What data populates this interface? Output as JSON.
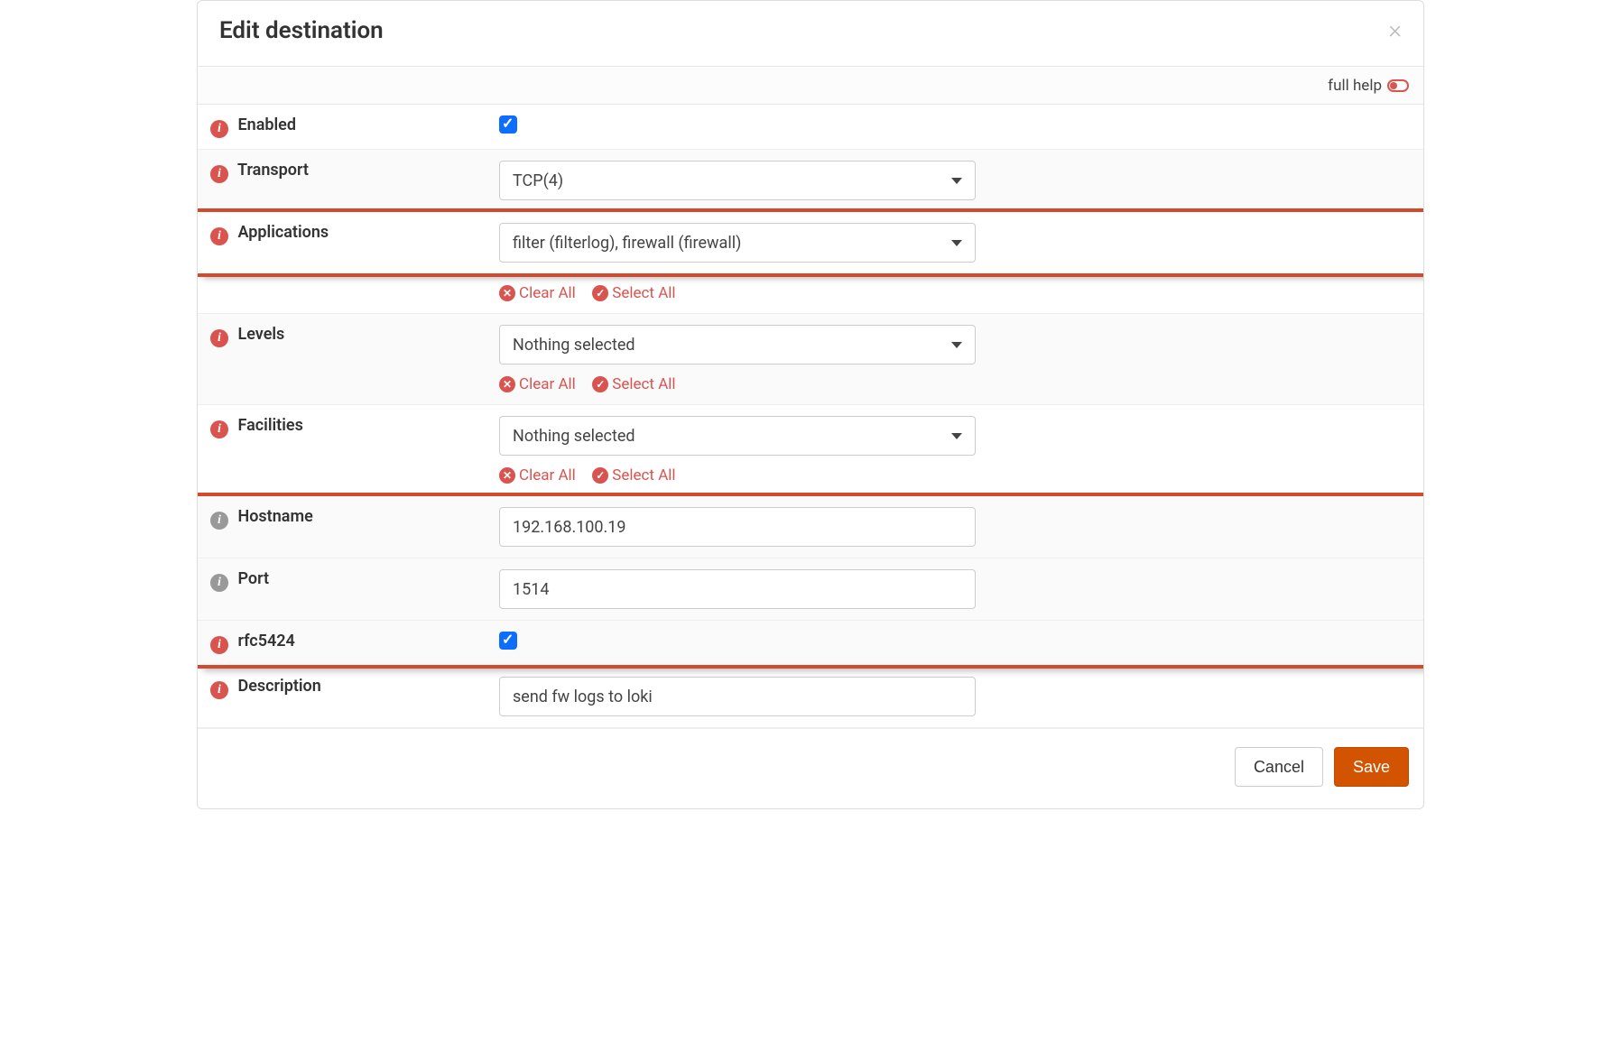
{
  "modal": {
    "title": "Edit destination",
    "help_label": "full help"
  },
  "labels": {
    "enabled": "Enabled",
    "transport": "Transport",
    "applications": "Applications",
    "levels": "Levels",
    "facilities": "Facilities",
    "hostname": "Hostname",
    "port": "Port",
    "rfc5424": "rfc5424",
    "description": "Description"
  },
  "values": {
    "transport": "TCP(4)",
    "applications": "filter (filterlog), firewall (firewall)",
    "levels": "Nothing selected",
    "facilities": "Nothing selected",
    "hostname": "192.168.100.19",
    "port": "1514",
    "description": "send fw logs to loki",
    "enabled_checked": true,
    "rfc5424_checked": true
  },
  "actions": {
    "clear_all": "Clear All",
    "select_all": "Select All"
  },
  "footer": {
    "cancel": "Cancel",
    "save": "Save"
  }
}
